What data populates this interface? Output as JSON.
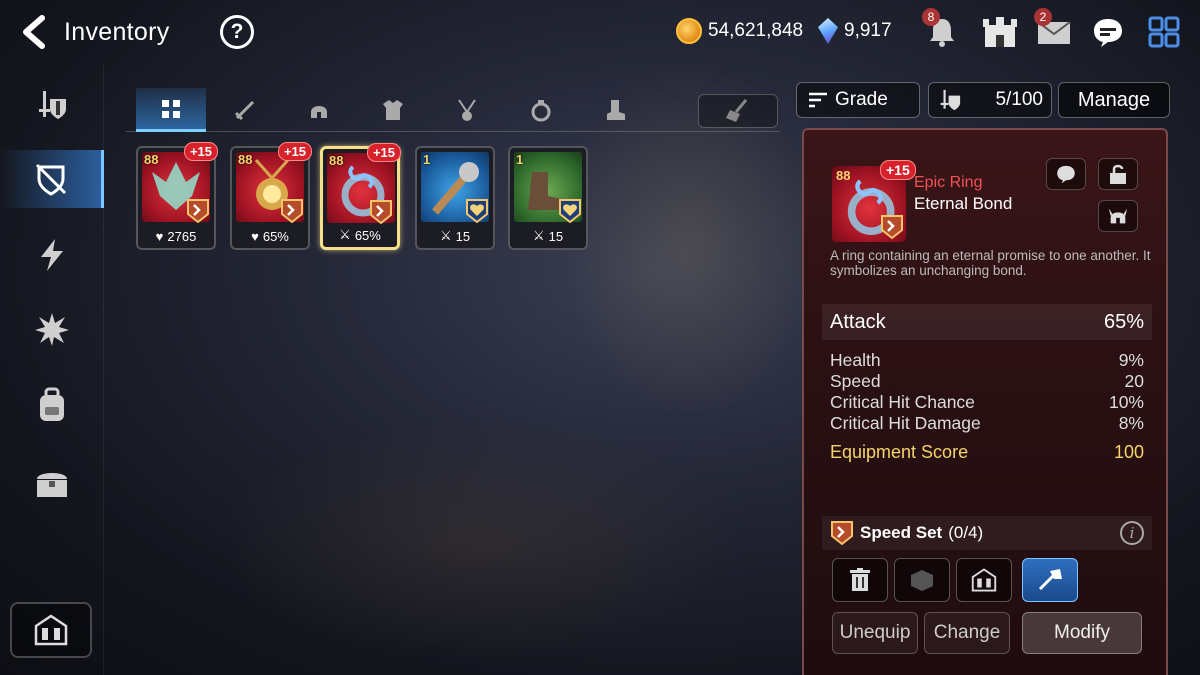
{
  "header": {
    "title": "Inventory",
    "gold": "54,621,848",
    "crystals": "9,917",
    "notification_count": "8",
    "mail_count": "2"
  },
  "icons": {
    "back": "back-arrow-icon",
    "help": "?",
    "notification": "bell-icon",
    "castle": "castle-icon",
    "mail": "mail-icon",
    "chat": "chat-icon",
    "menu": "grid-menu-icon"
  },
  "sidebar": {
    "items": [
      {
        "name": "sidebar-item-equipment",
        "icon": "sword-shield-icon"
      },
      {
        "name": "sidebar-item-artifacts",
        "icon": "shield-broken-icon",
        "active": true
      },
      {
        "name": "sidebar-item-catalysts",
        "icon": "lightning-icon"
      },
      {
        "name": "sidebar-item-materials",
        "icon": "burst-icon"
      },
      {
        "name": "sidebar-item-backpack",
        "icon": "backpack-icon"
      },
      {
        "name": "sidebar-item-chest",
        "icon": "chest-icon"
      }
    ],
    "bottom": "fortress-icon"
  },
  "categories": [
    {
      "name": "all",
      "active": true
    },
    {
      "name": "weapon"
    },
    {
      "name": "helmet"
    },
    {
      "name": "armor"
    },
    {
      "name": "necklace"
    },
    {
      "name": "ring"
    },
    {
      "name": "boots"
    }
  ],
  "items": [
    {
      "level": "88",
      "plus": "+15",
      "stat": "2765",
      "stat_icon": "heart",
      "color": "red",
      "set": "speed"
    },
    {
      "level": "88",
      "plus": "+15",
      "stat": "65%",
      "stat_icon": "heart",
      "color": "red",
      "set": "speed"
    },
    {
      "level": "88",
      "plus": "+15",
      "stat": "65%",
      "stat_icon": "sword",
      "color": "red",
      "set": "speed",
      "selected": true
    },
    {
      "level": "1",
      "plus": "",
      "stat": "15",
      "stat_icon": "sword",
      "color": "blue",
      "set": "health"
    },
    {
      "level": "1",
      "plus": "",
      "stat": "15",
      "stat_icon": "sword",
      "color": "green",
      "set": "health"
    }
  ],
  "controls": {
    "grade_label": "Grade",
    "capacity": "5/100",
    "manage_label": "Manage"
  },
  "detail": {
    "level": "88",
    "plus": "+15",
    "grade": "Epic Ring",
    "name": "Eternal Bond",
    "description": "A ring containing an eternal promise to one another. It symbolizes an unchanging bond.",
    "main_stat": {
      "label": "Attack",
      "value": "65%"
    },
    "sub_stats": [
      {
        "label": "Health",
        "value": "9%"
      },
      {
        "label": "Speed",
        "value": "20"
      },
      {
        "label": "Critical Hit Chance",
        "value": "10%"
      },
      {
        "label": "Critical Hit Damage",
        "value": "8%"
      }
    ],
    "score_label": "Equipment Score",
    "score_value": "100",
    "set_name": "Speed Set",
    "set_progress": "(0/4)",
    "buttons": {
      "unequip": "Unequip",
      "change": "Change",
      "modify": "Modify"
    }
  },
  "colors": {
    "accent": "#7cc6ff",
    "epic": "#f05252",
    "gold": "#f5d56b",
    "panel": "#2a1013"
  }
}
